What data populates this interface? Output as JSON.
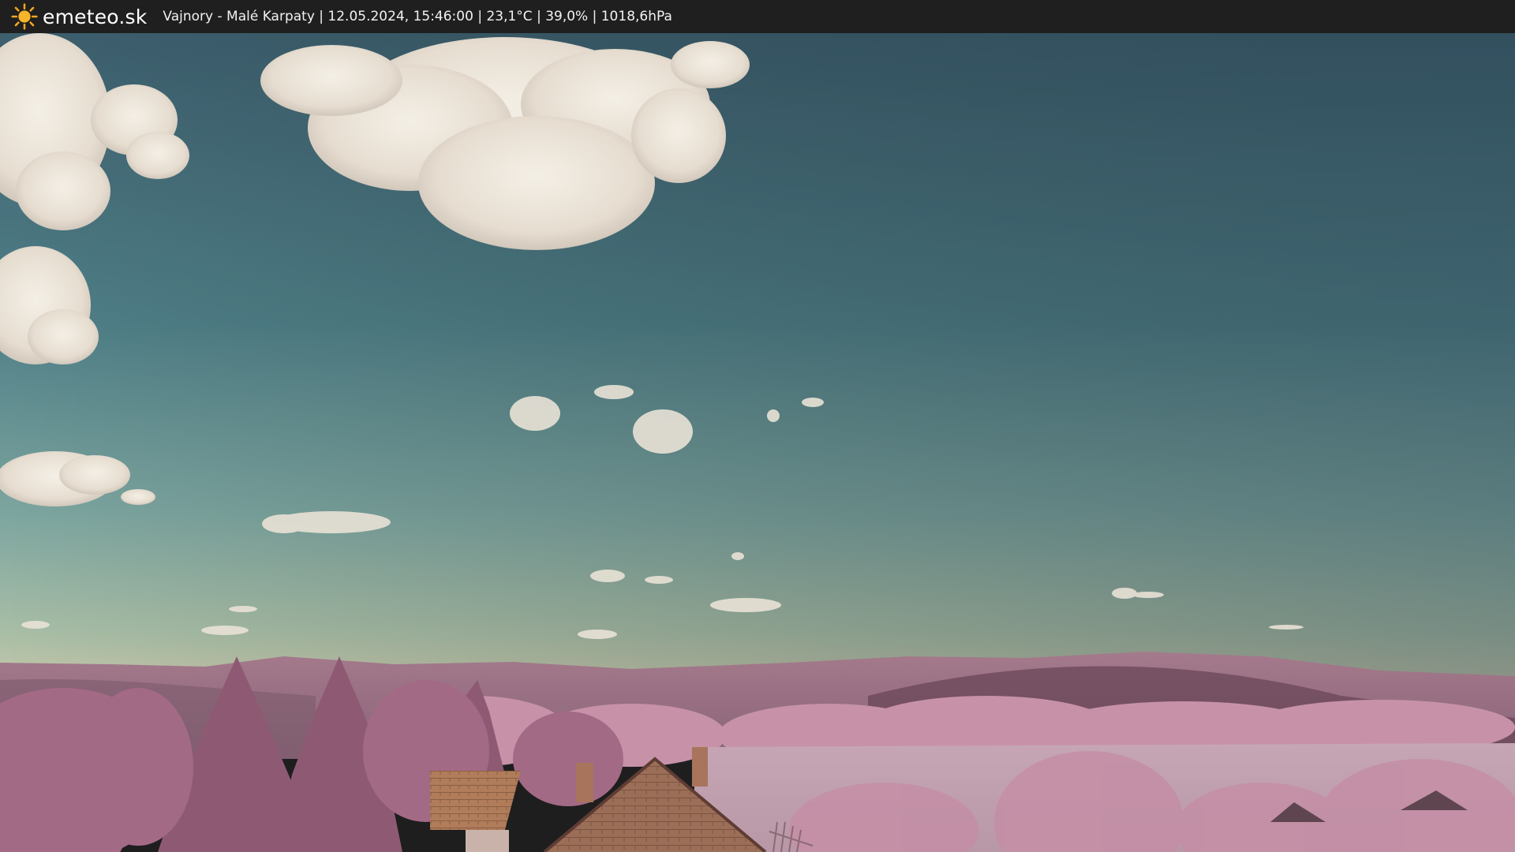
{
  "header": {
    "brand": "emeteo.sk",
    "logo_icon": "sun-icon",
    "caption": "Vajnory - Malé Karpaty | 12.05.2024, 15:46:00 | 23,1°C | 39,0% | 1018,6hPa"
  },
  "scene": {
    "image_type": "infrared-webcam-landscape"
  },
  "colors": {
    "bar": "#1f1f1f",
    "sun": "#f5a623",
    "sky_top": "#2f4a5c",
    "sky_bottom": "#8db0a8",
    "hills": "#9a6f86",
    "foliage": "#c08aa0"
  }
}
